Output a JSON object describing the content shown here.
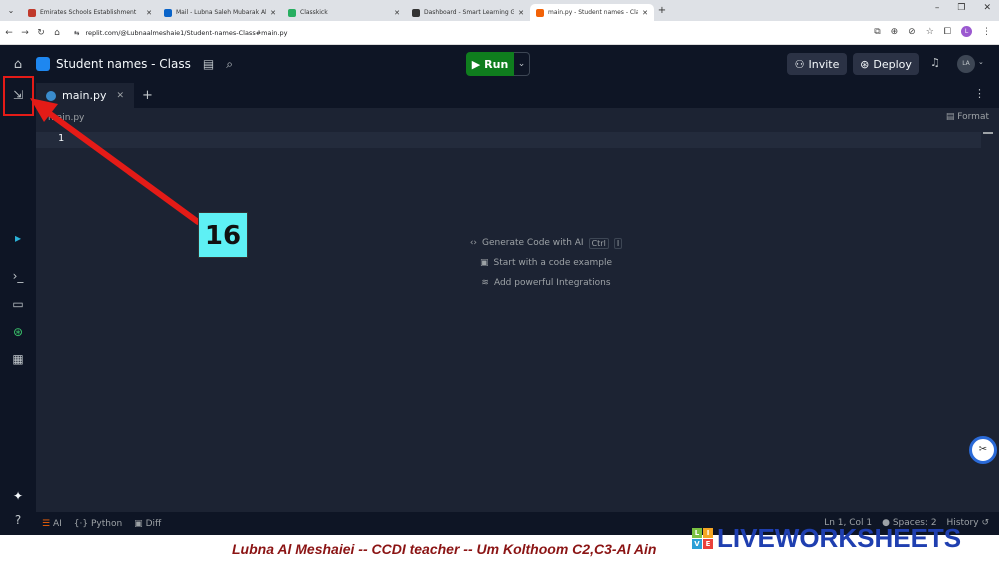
{
  "browser": {
    "tabs": [
      {
        "title": "Emirates Schools Establishment",
        "favicon_color": "#c0392b"
      },
      {
        "title": "Mail - Lubna Saleh Mubarak Al",
        "favicon_color": "#0a64c9"
      },
      {
        "title": "Classkick",
        "favicon_color": "#27ae60"
      },
      {
        "title": "Dashboard - Smart Learning Ga",
        "favicon_color": "#333333"
      },
      {
        "title": "main.py - Student names - Clas",
        "favicon_color": "#f26207"
      }
    ],
    "active_tab": 4,
    "url": "replit.com/@Lubnaalmeshaie1/Student-names-Class#main.py",
    "profile_initial": "L"
  },
  "replit": {
    "repl_title": "Student names - Class",
    "run_label": "Run",
    "invite_label": "Invite",
    "deploy_label": "Deploy",
    "avatar_initials": "LA",
    "file_tab": "main.py",
    "breadcrumb": "main.py",
    "format_label": "Format",
    "line_number": "1",
    "hints": {
      "generate": "Generate Code with AI",
      "kbd_ctrl": "Ctrl",
      "kbd_i": "I",
      "example": "Start with a code example",
      "integrations": "Add powerful Integrations"
    },
    "status": {
      "ai": "AI",
      "language": "Python",
      "diff": "Diff",
      "cursor": "Ln 1, Col 1",
      "spaces": "Spaces: 2",
      "history": "History"
    }
  },
  "overlay": {
    "step_number": "16"
  },
  "footer": {
    "credit": "Lubna Al Meshaiei -- CCDI teacher -- Um Kolthoom C2,C3-Al Ain",
    "logo_text": "LIVEWORKSHEETS",
    "logo_blocks": [
      "L",
      "I",
      "V",
      "E"
    ]
  },
  "colors": {
    "run_green": "#0f7d1e",
    "highlight_red": "#e41b17",
    "badge_cyan": "#5ef0f4",
    "credit_red": "#8b1414",
    "logo_blue": "#1f3fb0"
  }
}
